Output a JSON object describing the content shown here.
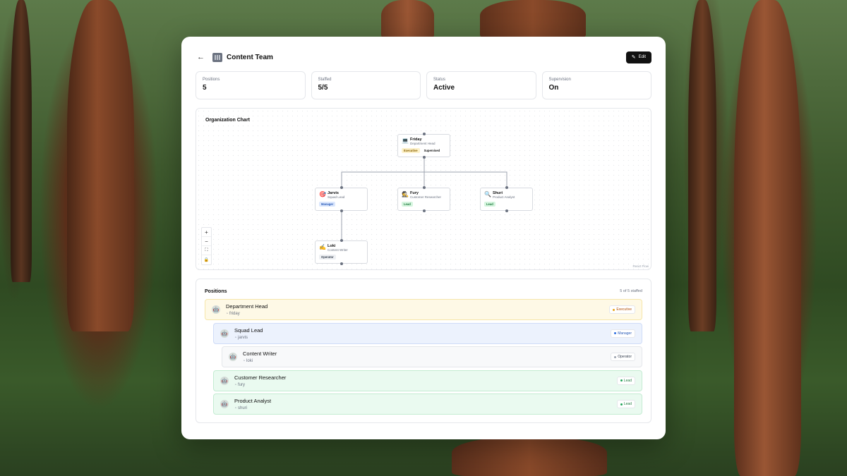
{
  "header": {
    "title": "Content Team",
    "edit_label": "Edit"
  },
  "stats": [
    {
      "label": "Positions",
      "value": "5"
    },
    {
      "label": "Staffed",
      "value": "5/5"
    },
    {
      "label": "Status",
      "value": "Active"
    },
    {
      "label": "Supervision",
      "value": "On"
    }
  ],
  "org_chart": {
    "title": "Organization Chart",
    "attribution": "React Flow",
    "nodes": [
      {
        "name": "Friday",
        "role": "Department Head",
        "emoji": "💻",
        "badges": [
          "Executive",
          "Supervised"
        ]
      },
      {
        "name": "Jarvis",
        "role": "Squad Lead",
        "emoji": "🎯",
        "badges": [
          "Manager"
        ]
      },
      {
        "name": "Fury",
        "role": "Customer Researcher",
        "emoji": "🕵",
        "badges": [
          "Lead"
        ]
      },
      {
        "name": "Shuri",
        "role": "Product Analyst",
        "emoji": "🔍",
        "badges": [
          "Lead"
        ]
      },
      {
        "name": "Loki",
        "role": "Content Writer",
        "emoji": "✍",
        "badges": [
          "Operator"
        ]
      }
    ],
    "controls": [
      "+",
      "−",
      "⛶",
      "🔒"
    ]
  },
  "positions": {
    "title": "Positions",
    "count": "5 of 5 staffed",
    "rows": [
      {
        "name": "Department Head",
        "agent": "friday",
        "badge": "Executive"
      },
      {
        "name": "Squad Lead",
        "agent": "jarvis",
        "badge": "Manager"
      },
      {
        "name": "Content Writer",
        "agent": "loki",
        "badge": "Operator"
      },
      {
        "name": "Customer Researcher",
        "agent": "fury",
        "badge": "Lead"
      },
      {
        "name": "Product Analyst",
        "agent": "shuri",
        "badge": "Lead"
      }
    ]
  },
  "colors": {
    "executive": "#e8a317",
    "manager": "#2f6fe0",
    "operator": "#9ca3af",
    "lead": "#22a55a"
  }
}
